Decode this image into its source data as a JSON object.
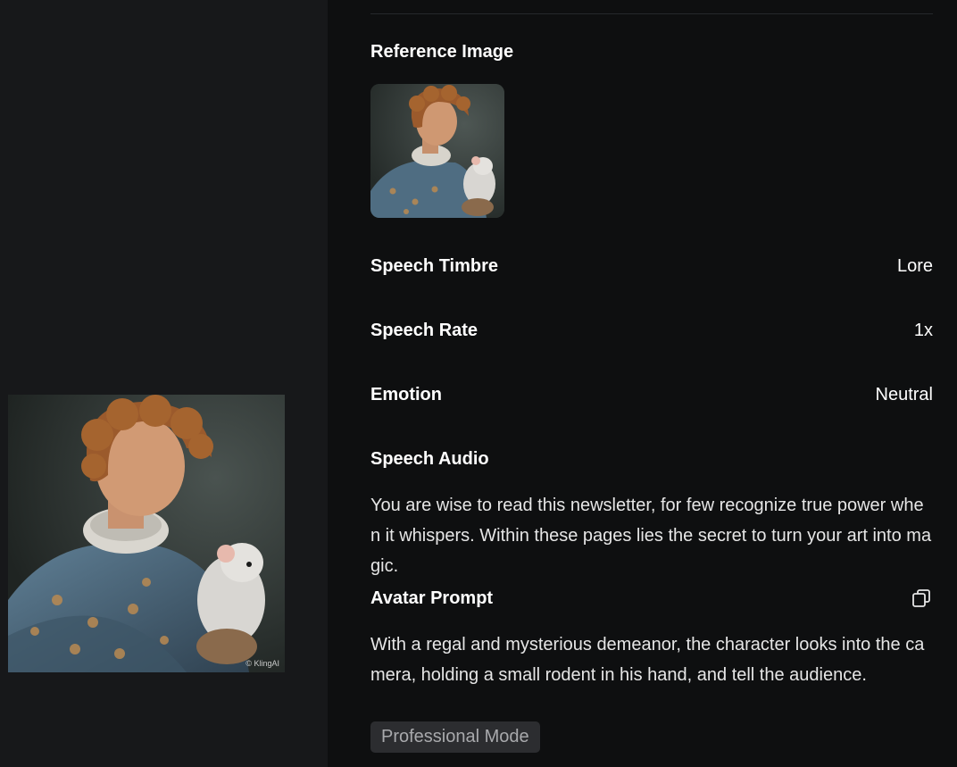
{
  "preview": {
    "image_alt": "Portrait of a curly-haired man in an ornate brocade doublet with a white rat on his shoulder",
    "watermark": "© KlingAI"
  },
  "details": {
    "reference_image": {
      "title": "Reference Image"
    },
    "speech_timbre": {
      "label": "Speech Timbre",
      "value": "Lore"
    },
    "speech_rate": {
      "label": "Speech Rate",
      "value": "1x"
    },
    "emotion": {
      "label": "Emotion",
      "value": "Neutral"
    },
    "speech_audio": {
      "title": "Speech Audio",
      "text": "You are wise to read this newsletter, for few recognize true power when it whispers. Within these pages lies the secret to turn your art into magic."
    },
    "avatar_prompt": {
      "title": "Avatar Prompt",
      "copy_icon": "copy-icon",
      "text": "With a regal and mysterious demeanor, the character looks into the camera, holding a small rodent in his hand, and tell the audience."
    },
    "mode_badge": "Professional Mode"
  },
  "colors": {
    "left_bg": "#17181a",
    "right_bg": "#0e0f10",
    "text": "#ffffff",
    "badge_bg": "#2c2d30",
    "badge_text": "#a8a9ac"
  }
}
